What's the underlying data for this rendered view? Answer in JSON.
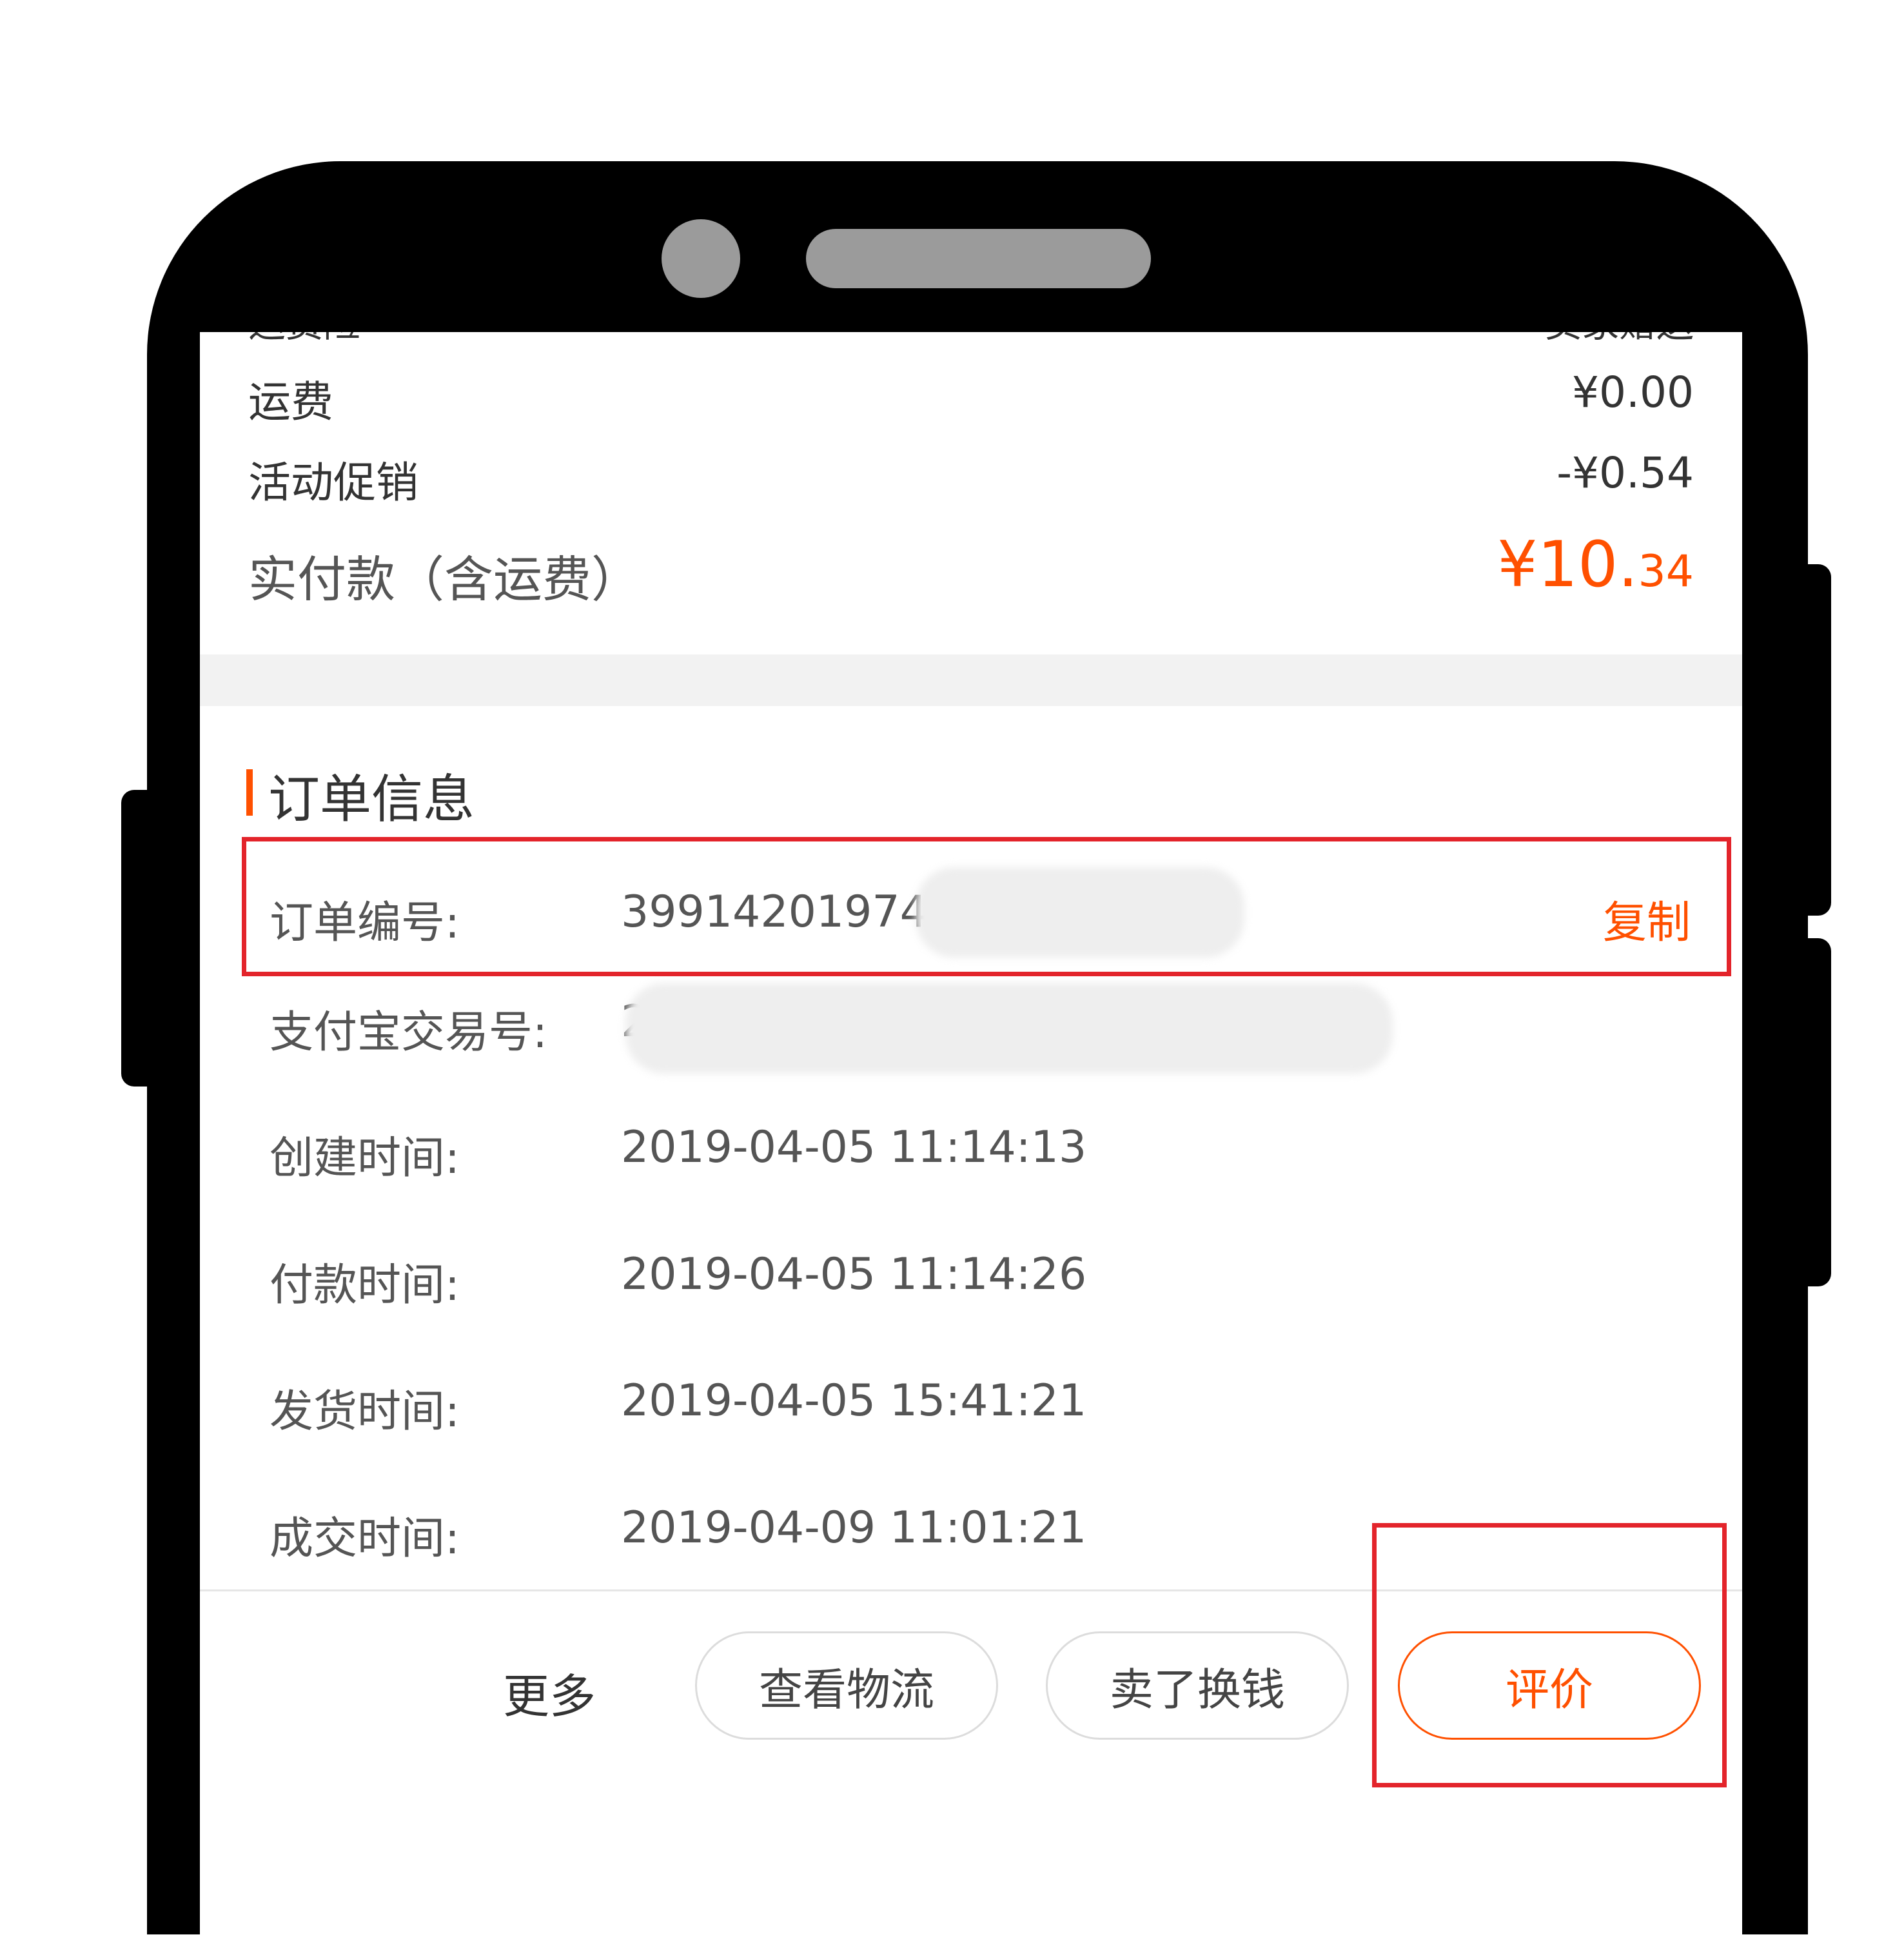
{
  "summary": {
    "partial_top_left": "运费险",
    "partial_top_right": "卖家赠送",
    "shipping_label": "运费",
    "shipping_value": "¥0.00",
    "promo_label": "活动促销",
    "promo_value": "-¥0.54",
    "total_label": "实付款（含运费）",
    "total_yuan": "¥10.",
    "total_cents": "34"
  },
  "order_info": {
    "title": "订单信息",
    "order_no_label": "订单编号:",
    "order_no_value": "39914201974",
    "copy_label": "复制",
    "alipay_label": "支付宝交易号:",
    "alipay_value": "2",
    "created_label": "创建时间:",
    "created_value": "2019-04-05 11:14:13",
    "paid_label": "付款时间:",
    "paid_value": "2019-04-05 11:14:26",
    "shipped_label": "发货时间:",
    "shipped_value": "2019-04-05 15:41:21",
    "closed_label": "成交时间:",
    "closed_value": "2019-04-09 11:01:21"
  },
  "actions": {
    "more": "更多",
    "logistics": "查看物流",
    "sell": "卖了换钱",
    "review": "评价"
  },
  "colors": {
    "accent": "#ff5000",
    "highlight": "#e3242b"
  }
}
